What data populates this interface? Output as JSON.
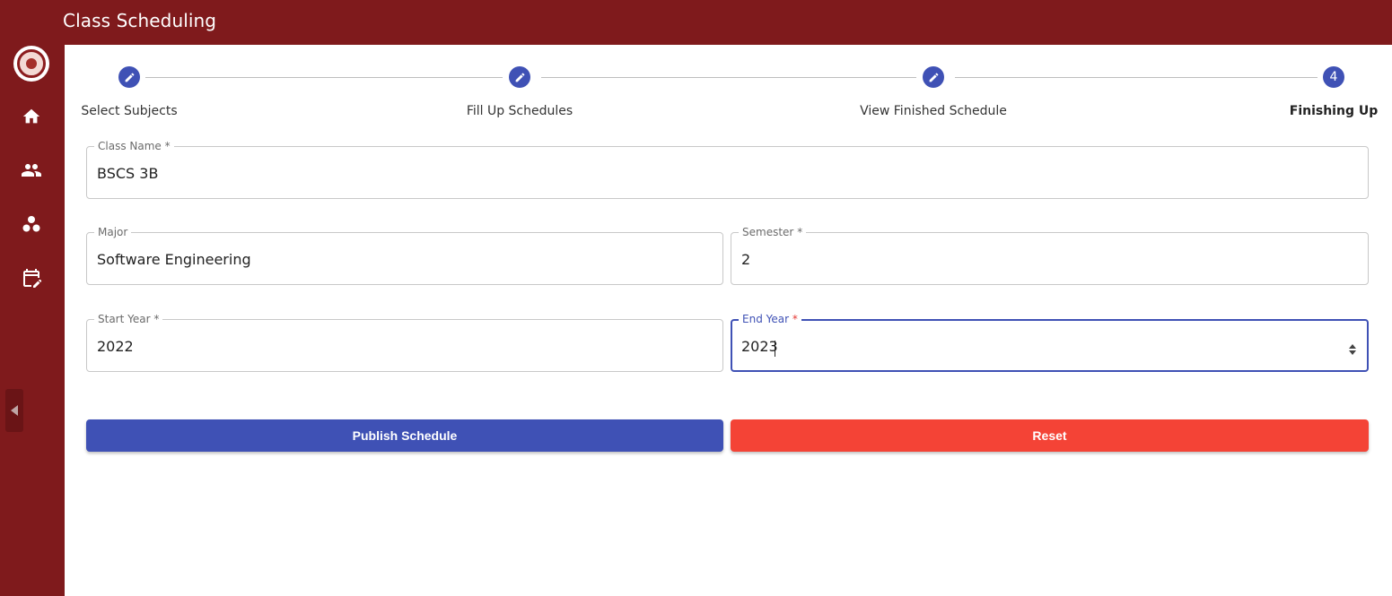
{
  "app": {
    "title": "Class Scheduling"
  },
  "sidebar": {
    "items": [
      {
        "icon": "home-icon"
      },
      {
        "icon": "people-icon"
      },
      {
        "icon": "groups-icon"
      },
      {
        "icon": "edit-calendar-icon"
      }
    ],
    "collapse_icon": "chevron-left-icon"
  },
  "stepper": {
    "steps": [
      {
        "label": "Select Subjects",
        "state": "completed",
        "icon": "pencil-icon"
      },
      {
        "label": "Fill Up Schedules",
        "state": "completed",
        "icon": "pencil-icon"
      },
      {
        "label": "View Finished Schedule",
        "state": "completed",
        "icon": "pencil-icon"
      },
      {
        "label": "Finishing Up",
        "state": "active",
        "number": "4"
      }
    ]
  },
  "form": {
    "class_name": {
      "label": "Class Name",
      "required": "*",
      "value": "BSCS 3B"
    },
    "major": {
      "label": "Major",
      "value": "Software Engineering"
    },
    "semester": {
      "label": "Semester",
      "required": "*",
      "value": "2"
    },
    "start_year": {
      "label": "Start Year",
      "required": "*",
      "value": "2022"
    },
    "end_year": {
      "label": "End Year",
      "required": "*",
      "value": "2023",
      "focused": true
    }
  },
  "actions": {
    "publish_label": "Publish Schedule",
    "reset_label": "Reset"
  },
  "colors": {
    "brand": "#7f1a1c",
    "primary": "#3f51b5",
    "danger": "#f44336"
  }
}
